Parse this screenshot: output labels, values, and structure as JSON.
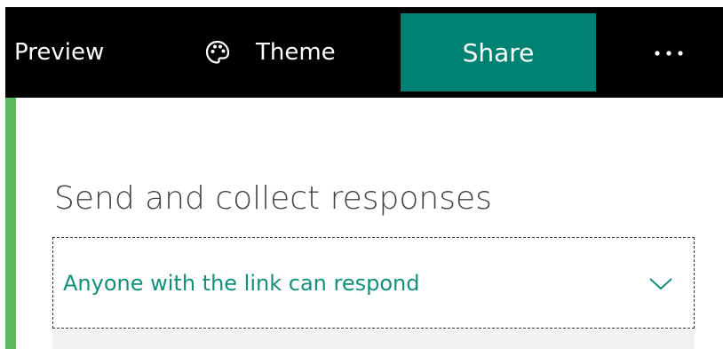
{
  "topbar": {
    "preview_label": "Preview",
    "theme_label": "Theme",
    "theme_icon": "palette-icon",
    "share_label": "Share",
    "more_icon": "more-dots-icon"
  },
  "colors": {
    "topbar_bg": "#000000",
    "share_bg": "#008272",
    "accent_green": "#5cb85c",
    "link_text": "#13907c"
  },
  "panel": {
    "heading": "Send and collect responses",
    "permission_dropdown": {
      "selected": "Anyone with the link can respond",
      "chevron_icon": "chevron-down-icon"
    }
  }
}
